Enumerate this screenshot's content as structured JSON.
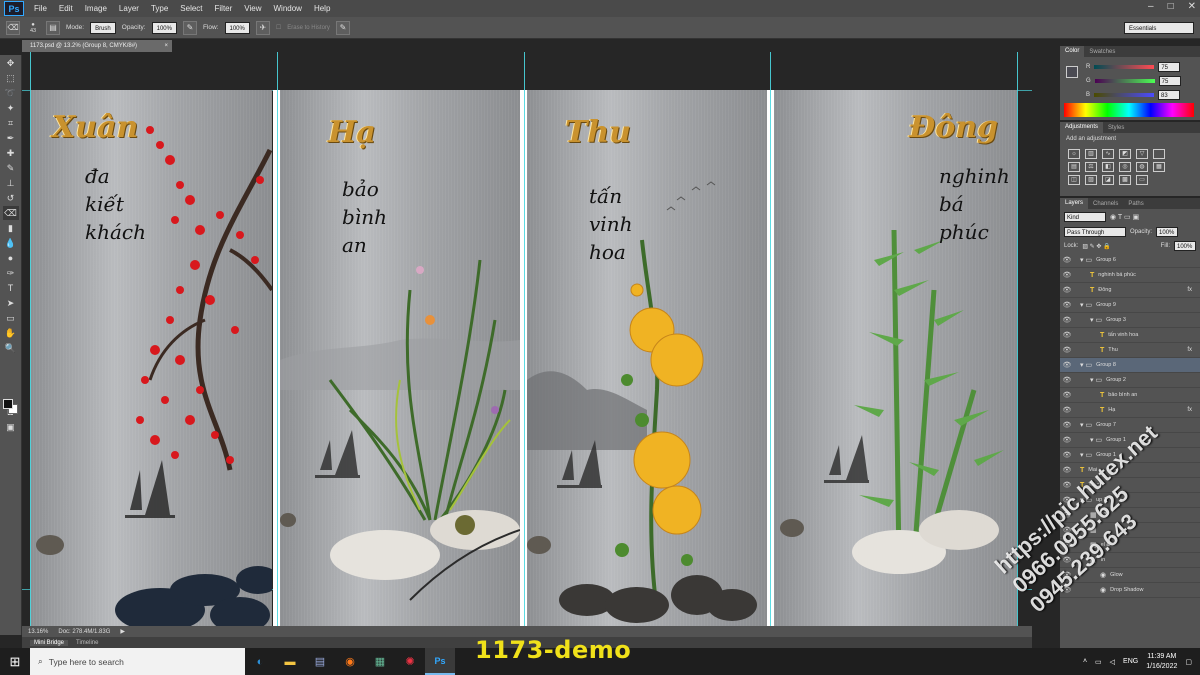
{
  "menubar": {
    "logo": "Ps",
    "items": [
      "File",
      "Edit",
      "Image",
      "Layer",
      "Type",
      "Select",
      "Filter",
      "View",
      "Window",
      "Help"
    ]
  },
  "options": {
    "brush_size": "43",
    "mode_label": "Mode:",
    "mode_value": "Brush",
    "opacity_label": "Opacity:",
    "opacity_value": "100%",
    "flow_label": "Flow:",
    "flow_value": "100%",
    "erase_history": "Erase to History",
    "workspace": "Essentials"
  },
  "document": {
    "tab_title": "1173.psd @ 13.2% (Group 8, CMYK/8#)",
    "close": "×"
  },
  "artwork": {
    "panel1": {
      "title": "Xuân",
      "lines": [
        "đa",
        "kiết",
        "khách"
      ]
    },
    "panel2": {
      "title": "Hạ",
      "lines": [
        "bảo",
        "bình",
        "an"
      ]
    },
    "panel3": {
      "title": "Thu",
      "lines": [
        "tấn",
        "vinh",
        "hoa"
      ]
    },
    "panel4": {
      "title": "Đông",
      "lines": [
        "nghinh",
        "bá",
        "phúc"
      ]
    }
  },
  "status": {
    "zoom": "13.16%",
    "doc": "Doc: 278.4M/1.83G"
  },
  "bottom_tabs": [
    "Mini Bridge",
    "Timeline"
  ],
  "color_panel": {
    "tabs": [
      "Color",
      "Swatches"
    ],
    "r": "75",
    "g": "75",
    "b": "83"
  },
  "adjustments": {
    "tabs": [
      "Adjustments",
      "Styles"
    ],
    "heading": "Add an adjustment"
  },
  "layers_panel": {
    "tabs": [
      "Layers",
      "Channels",
      "Paths"
    ],
    "filter": "Kind",
    "blend": "Pass Through",
    "opacity_label": "Opacity:",
    "opacity_value": "100%",
    "lock_label": "Lock:",
    "fill_label": "Fill:",
    "fill_value": "100%",
    "layers": [
      {
        "name": "Group 6",
        "indent": 0,
        "kind": "group"
      },
      {
        "name": "nghinh bá phúc",
        "indent": 1,
        "kind": "text"
      },
      {
        "name": "Đông",
        "indent": 1,
        "kind": "text",
        "fx": "fx"
      },
      {
        "name": "Group 9",
        "indent": 0,
        "kind": "group"
      },
      {
        "name": "Group 3",
        "indent": 1,
        "kind": "group"
      },
      {
        "name": "tấn vinh hoa",
        "indent": 2,
        "kind": "text"
      },
      {
        "name": "Thu",
        "indent": 2,
        "kind": "text",
        "fx": "fx"
      },
      {
        "name": "Group 8",
        "indent": 0,
        "kind": "group",
        "selected": true
      },
      {
        "name": "Group 2",
        "indent": 1,
        "kind": "group"
      },
      {
        "name": "bảo bình an",
        "indent": 2,
        "kind": "text"
      },
      {
        "name": "Hạ",
        "indent": 2,
        "kind": "text",
        "fx": "fx"
      },
      {
        "name": "Group 7",
        "indent": 0,
        "kind": "group"
      },
      {
        "name": "Group 1",
        "indent": 1,
        "kind": "group"
      },
      {
        "name": "Group 1",
        "indent": 0,
        "kind": "group"
      },
      {
        "name": "Mai",
        "indent": 0,
        "kind": "text"
      },
      {
        "name": "Trúc",
        "indent": 0,
        "kind": "text"
      },
      {
        "name": "up 1",
        "indent": 0,
        "kind": "group"
      },
      {
        "name": "23",
        "indent": 1,
        "kind": "image"
      },
      {
        "name": "",
        "indent": 1,
        "kind": "image"
      },
      {
        "name": "el &",
        "indent": 1,
        "kind": "image"
      },
      {
        "name": "In",
        "indent": 1,
        "kind": "image"
      },
      {
        "name": "Glow",
        "indent": 2,
        "kind": "effect"
      },
      {
        "name": "Drop Shadow",
        "indent": 2,
        "kind": "effect"
      }
    ]
  },
  "taskbar": {
    "search_placeholder": "Type here to search",
    "language": "ENG",
    "time": "11:39 AM",
    "date": "1/16/2022"
  },
  "overlay": {
    "demo_label": "1173-demo",
    "watermark_lines": [
      "https://pic.hutex.net",
      "0966.0955.625",
      "0945.239.643"
    ]
  }
}
